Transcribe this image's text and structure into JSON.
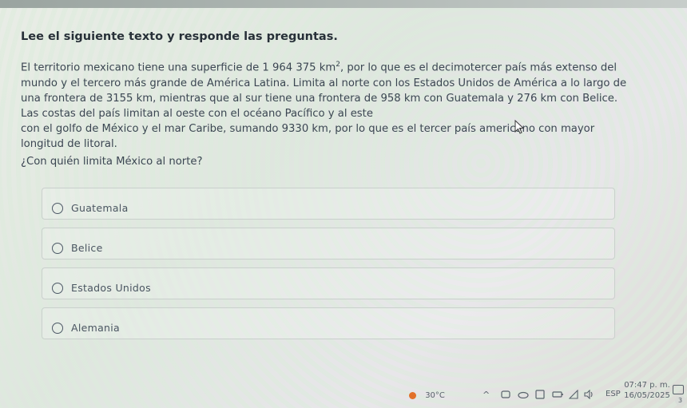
{
  "quiz": {
    "heading": "Lee el siguiente texto y responde las preguntas.",
    "passage": {
      "line1_a": "El territorio mexicano tiene una superficie de 1 964 375 km",
      "line1_sup": "2",
      "line1_b": ", por lo que es el decimotercer país más extenso del",
      "line2": "mundo y el tercero más grande de América Latina. Limita al norte con los Estados Unidos de América a lo largo de",
      "line3": "una frontera de 3155 km, mientras que al sur tiene una frontera de 958 km con Guatemala y 276 km con Belice.",
      "line4": "Las costas del país limitan al oeste con el océano Pacífico y al este",
      "line5": "con el golfo de México y el mar Caribe, sumando 9330 km, por lo que es el tercer país americano con mayor",
      "line6": "longitud de litoral."
    },
    "question": "¿Con quién limita México al norte?",
    "options": [
      {
        "label": "Guatemala"
      },
      {
        "label": "Belice"
      },
      {
        "label": "Estados Unidos"
      },
      {
        "label": "Alemania"
      }
    ]
  },
  "taskbar": {
    "temperature": "30°C",
    "language": "ESP",
    "time": "07:47 p. m.",
    "date": "16/05/2025",
    "notification_count": "3"
  }
}
